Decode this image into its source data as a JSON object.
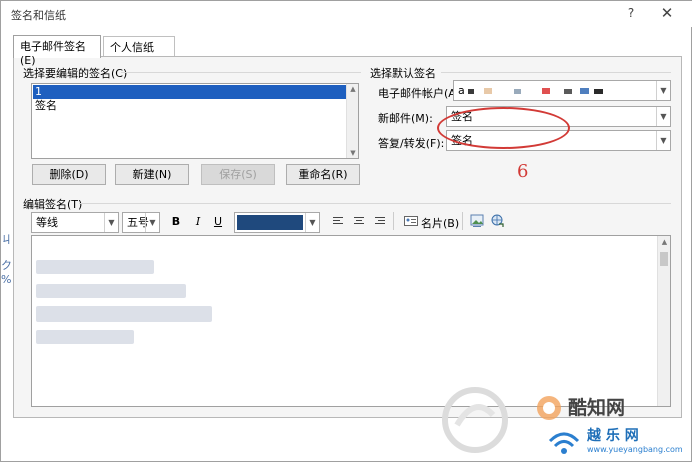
{
  "window": {
    "title": "签名和信纸",
    "help_symbol": "?",
    "close_symbol": "✕"
  },
  "tabs": [
    {
      "label": "电子邮件签名(E)",
      "active": true
    },
    {
      "label": "个人信纸(P)",
      "active": false
    }
  ],
  "signatures": {
    "label": "选择要编辑的签名(C)",
    "items": [
      {
        "label": "1",
        "selected": true
      },
      {
        "label": "签名",
        "selected": false
      }
    ],
    "buttons": {
      "delete": "删除(D)",
      "new": "新建(N)",
      "save": "保存(S)",
      "rename": "重命名(R)"
    }
  },
  "defaults": {
    "label": "选择默认签名",
    "account_label": "电子邮件帐户(A):",
    "account_value": "a",
    "new_label": "新邮件(M):",
    "new_value": "签名",
    "reply_label": "答复/转发(F):",
    "reply_value": "签名"
  },
  "annotation": {
    "number": "6",
    "color": "#d23a36"
  },
  "editor": {
    "label": "编辑签名(T)",
    "font": "等线",
    "size": "五号",
    "bold": "B",
    "italic": "I",
    "underline": "U",
    "color_value": "#1f497d",
    "business_card": "名片(B)",
    "insert_picture_icon": "picture-icon",
    "insert_link_icon": "hyperlink-icon"
  },
  "watermark": {
    "brand_top": "酷知网",
    "brand_bottom": "越 乐 网",
    "url": "www.yueyangbang.com"
  },
  "left_edge": {
    "glyphs": [
      "ㄐ",
      "ク",
      "%"
    ]
  }
}
